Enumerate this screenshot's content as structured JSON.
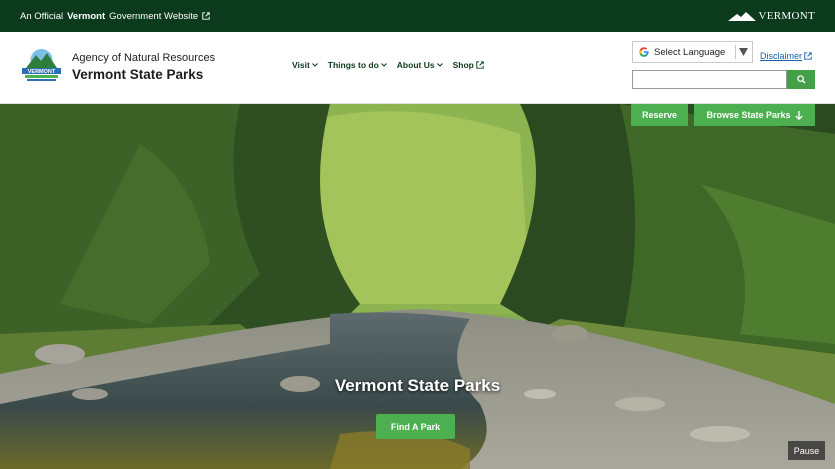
{
  "gov_bar": {
    "prefix": "An Official",
    "state": "Vermont",
    "suffix": "Government Website",
    "wordmark": "VERMONT"
  },
  "header": {
    "agency": "Agency of Natural Resources",
    "title": "Vermont State Parks",
    "logo_text": "VERMONT"
  },
  "nav": {
    "items": [
      {
        "label": "Visit"
      },
      {
        "label": "Things to do"
      },
      {
        "label": "About Us"
      },
      {
        "label": "Shop"
      }
    ]
  },
  "translate": {
    "label": "Select Language"
  },
  "disclaimer": "Disclaimer",
  "search": {
    "value": ""
  },
  "hero": {
    "reserve_label": "Reserve",
    "browse_label": "Browse State Parks",
    "title": "Vermont State Parks",
    "find_label": "Find A Park",
    "pause_label": "Pause"
  },
  "colors": {
    "gov_bar": "#0b3a1c",
    "accent_green": "#4caf50",
    "link_blue": "#1c5fa8"
  }
}
